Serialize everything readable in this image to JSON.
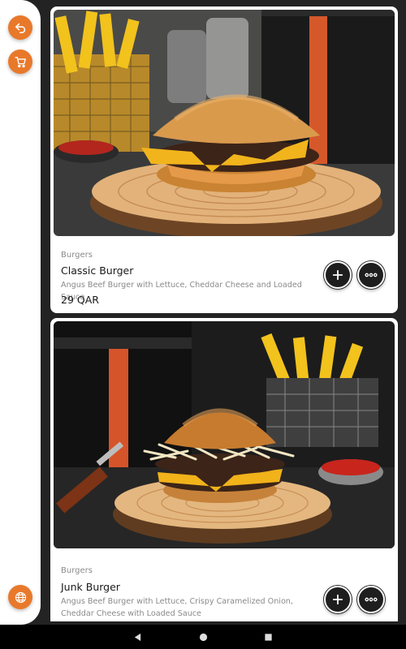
{
  "sidebar": {
    "buttons": [
      {
        "name": "back",
        "icon": "back-arrow-icon"
      },
      {
        "name": "cart",
        "icon": "cart-icon"
      },
      {
        "name": "language",
        "icon": "globe-icon"
      }
    ],
    "accent_color": "#e8792b"
  },
  "menu_items": [
    {
      "category": "Burgers",
      "name": "Classic Burger",
      "description": "Angus Beef Burger with Lettuce, Cheddar Cheese and Loaded Sauce",
      "price": "29 QAR",
      "image_icon": "classic-burger-photo",
      "actions": [
        "add-icon",
        "more-icon"
      ]
    },
    {
      "category": "Burgers",
      "name": "Junk Burger",
      "description": "Angus Beef Burger with Lettuce, Crispy Caramelized Onion, Cheddar Cheese with Loaded Sauce",
      "price": "",
      "image_icon": "junk-burger-photo",
      "actions": [
        "add-icon",
        "more-icon"
      ]
    }
  ],
  "navigation_bar": {
    "buttons": [
      "back-triangle-icon",
      "home-circle-icon",
      "recents-square-icon"
    ]
  }
}
